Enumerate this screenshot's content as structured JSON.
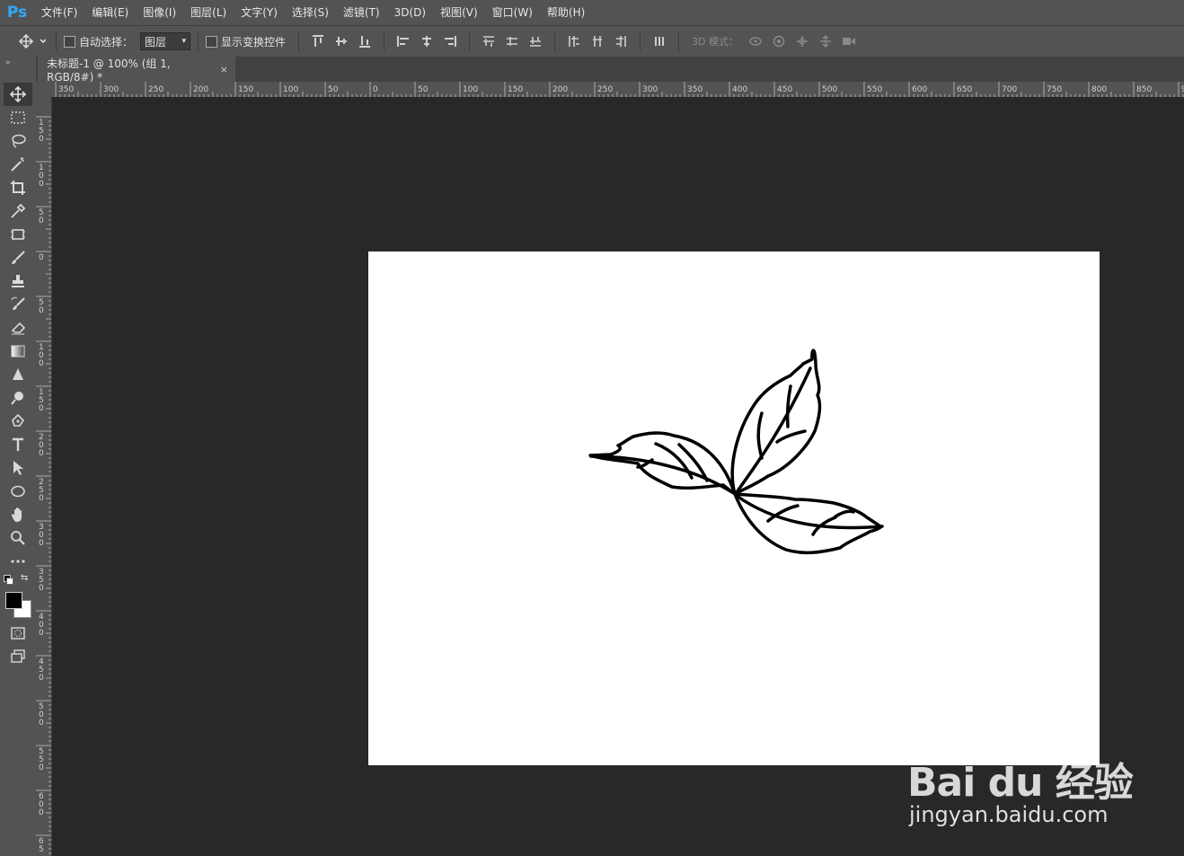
{
  "app": {
    "logo": "Ps"
  },
  "menu": [
    "文件(F)",
    "编辑(E)",
    "图像(I)",
    "图层(L)",
    "文字(Y)",
    "选择(S)",
    "滤镜(T)",
    "3D(D)",
    "视图(V)",
    "窗口(W)",
    "帮助(H)"
  ],
  "options": {
    "auto_select_label": "自动选择：",
    "auto_select_value": "图层",
    "show_transform_label": "显示变换控件",
    "mode_label": "3D 模式："
  },
  "document": {
    "tab_title": "未标题-1 @ 100% (组 1, RGB/8#) *",
    "close_glyph": "×"
  },
  "ruler": {
    "h_labels": [
      "350",
      "300",
      "250",
      "200",
      "150",
      "100",
      "50",
      "0",
      "50",
      "100",
      "150",
      "200",
      "250",
      "300",
      "350",
      "400",
      "450",
      "500",
      "550",
      "600",
      "650",
      "700",
      "750",
      "800",
      "850",
      "9"
    ],
    "v_labels": [
      "150",
      "100",
      "50",
      "0",
      "50",
      "100",
      "150",
      "200",
      "250",
      "300",
      "350",
      "400",
      "450",
      "500",
      "550",
      "600",
      "65"
    ]
  },
  "watermark": {
    "brand": "Bai du 经验",
    "url": "jingyan.baidu.com"
  },
  "colors": {
    "foreground": "#000000",
    "background": "#ffffff",
    "ps_blue": "#31a8ff"
  }
}
